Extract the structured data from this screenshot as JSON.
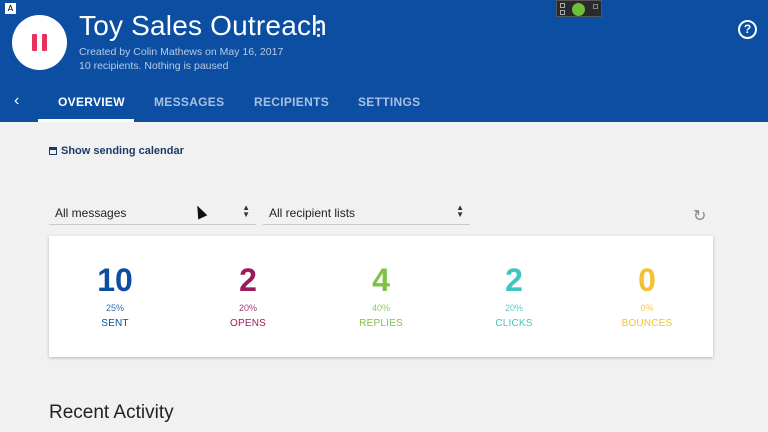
{
  "header": {
    "title": "Toy Sales Outreach",
    "created_by": "Created by Colin Mathews on May 16, 2017",
    "status": "10 recipients. Nothing is paused",
    "help_label": "?",
    "corner_label": "A"
  },
  "tabs": [
    {
      "label": "OVERVIEW",
      "active": true
    },
    {
      "label": "MESSAGES",
      "active": false
    },
    {
      "label": "RECIPIENTS",
      "active": false
    },
    {
      "label": "SETTINGS",
      "active": false
    }
  ],
  "calendar_link": "Show sending calendar",
  "filters": {
    "messages": "All messages",
    "recipients": "All recipient lists"
  },
  "stats": [
    {
      "value": "10",
      "percent": "25%",
      "label": "SENT",
      "color": "#0b4ea2"
    },
    {
      "value": "2",
      "percent": "20%",
      "label": "OPENS",
      "color": "#9b1b5a"
    },
    {
      "value": "4",
      "percent": "40%",
      "label": "REPLIES",
      "color": "#7fc243"
    },
    {
      "value": "2",
      "percent": "20%",
      "label": "CLICKS",
      "color": "#3fc6c1"
    },
    {
      "value": "0",
      "percent": "0%",
      "label": "BOUNCES",
      "color": "#f2c230"
    }
  ],
  "recent_activity_title": "Recent Activity",
  "icons": {
    "pause": "pause-icon",
    "more": "kebab-icon",
    "help": "help-icon",
    "back": "chevron-left-icon",
    "calendar": "calendar-icon",
    "refresh": "refresh-icon"
  }
}
